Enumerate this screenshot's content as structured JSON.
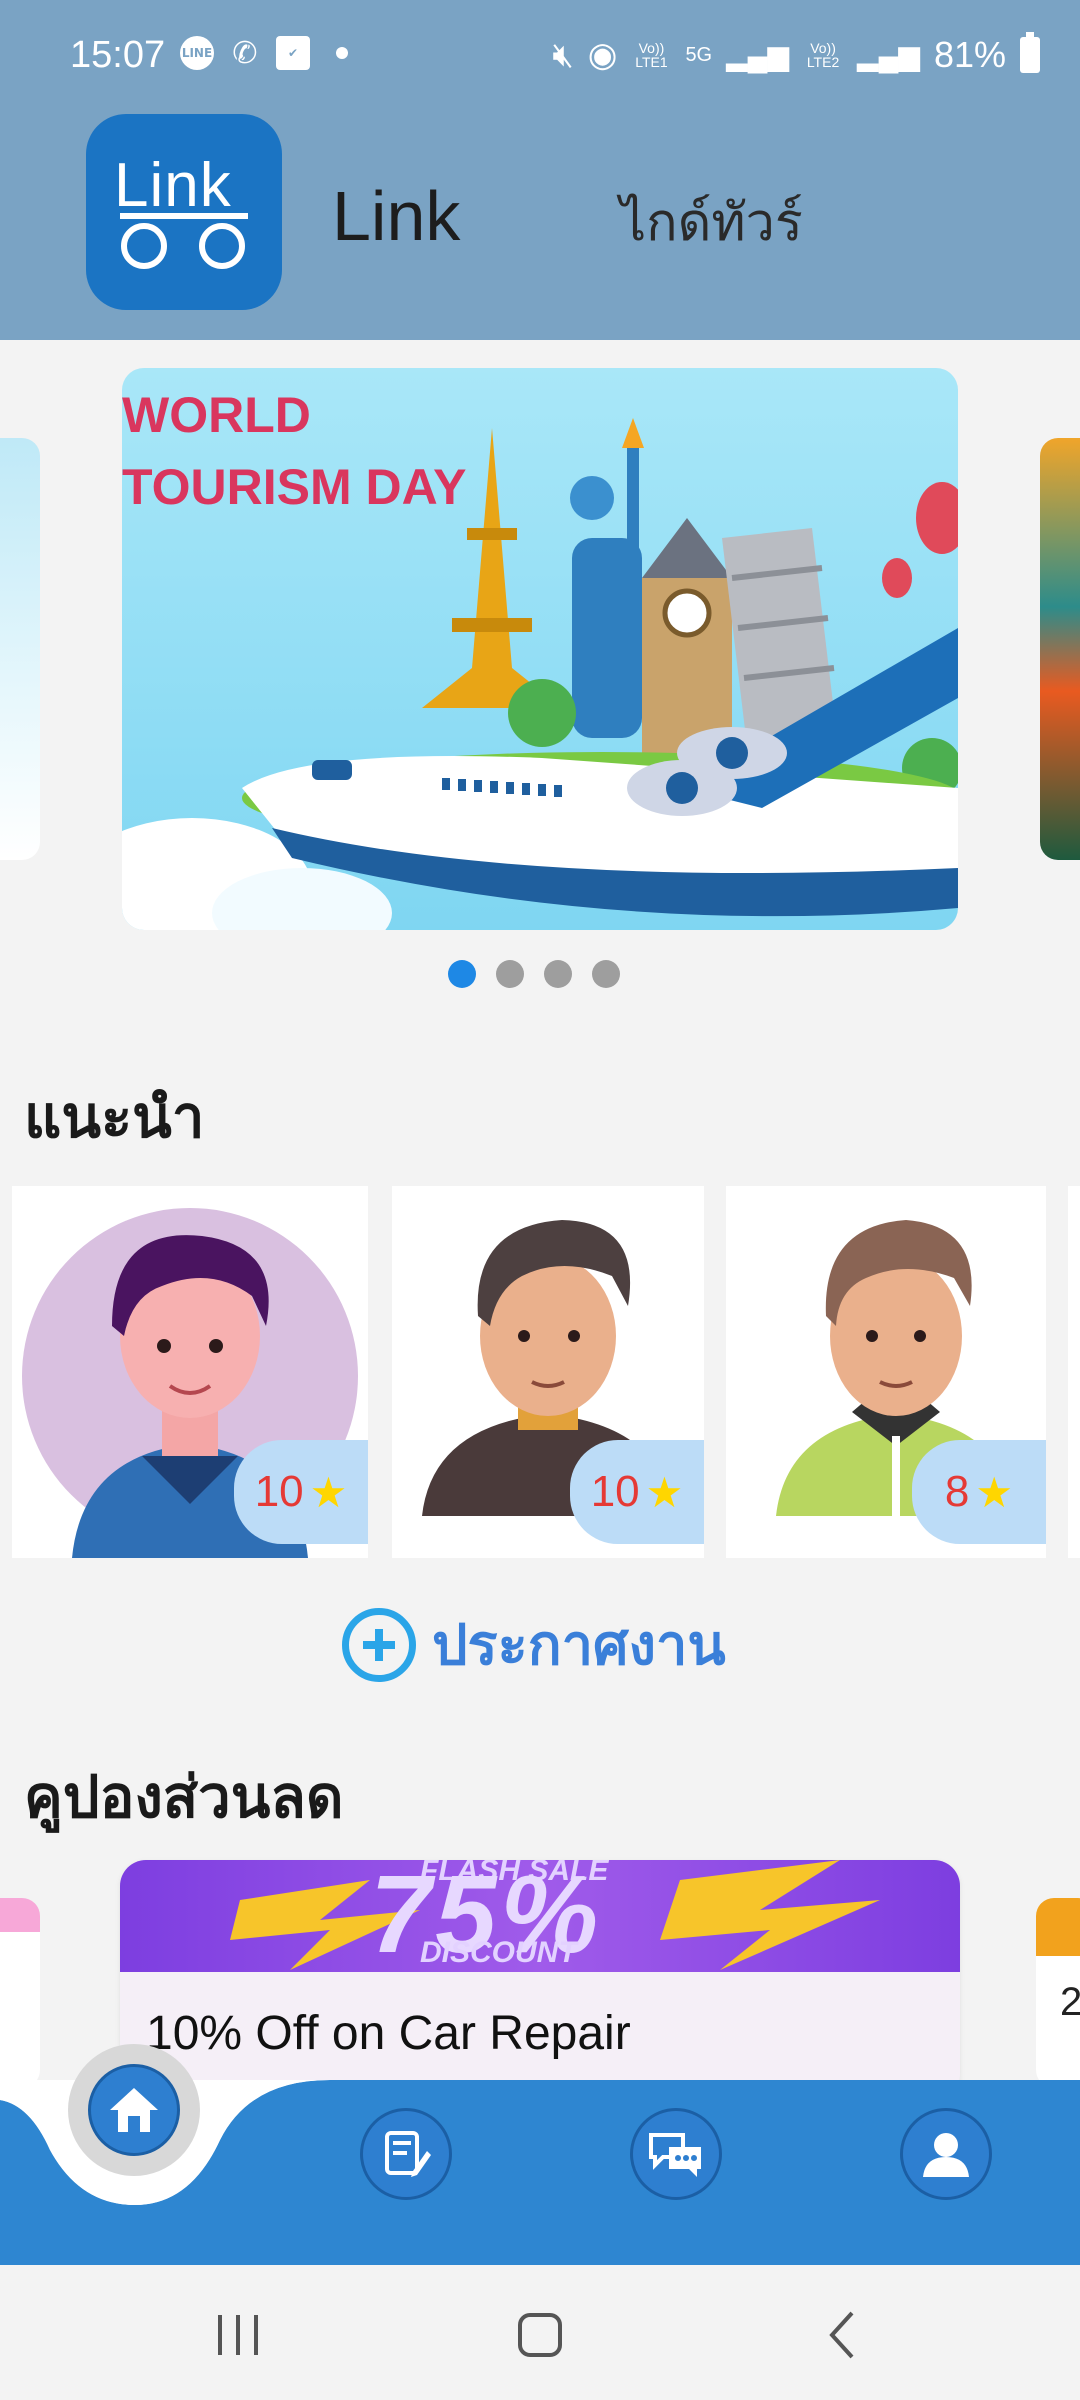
{
  "status_bar": {
    "time": "15:07",
    "battery": "81%",
    "icons_left": [
      "line-icon",
      "missed-call-icon",
      "check-icon"
    ],
    "icons_right": [
      "mute-icon",
      "hotspot-icon",
      "volte1-icon",
      "5g-icon",
      "signal1-icon",
      "volte2-icon",
      "signal2-icon",
      "battery-icon"
    ],
    "network": "5G",
    "volte1": "Vo)) LTE1",
    "volte2": "Vo)) LTE2"
  },
  "header": {
    "logo_text": "Link",
    "title": "Link",
    "subtitle": "ไกด์ทัวร์",
    "background": "#7aa3c4"
  },
  "banner": {
    "line1": "WORLD",
    "line2": "TOURISM DAY",
    "page_count": 4,
    "active_page": 1
  },
  "recommended": {
    "heading": "แนะนำ",
    "guides": [
      {
        "rating": "10"
      },
      {
        "rating": "10"
      },
      {
        "rating": "8"
      }
    ]
  },
  "post_job": {
    "label": "ประกาศงาน"
  },
  "coupons": {
    "heading": "คูปองส่วนลด",
    "main": {
      "banner_top": "FLASH SALE",
      "banner_big": "75%",
      "banner_bottom": "DISCOUNT",
      "title": "10% Off on Car Repair"
    },
    "right_peek": "2"
  },
  "bottom_nav": {
    "items": [
      "home-icon",
      "post-edit-icon",
      "chat-icon",
      "profile-icon"
    ],
    "accent": "#2e86d1"
  }
}
